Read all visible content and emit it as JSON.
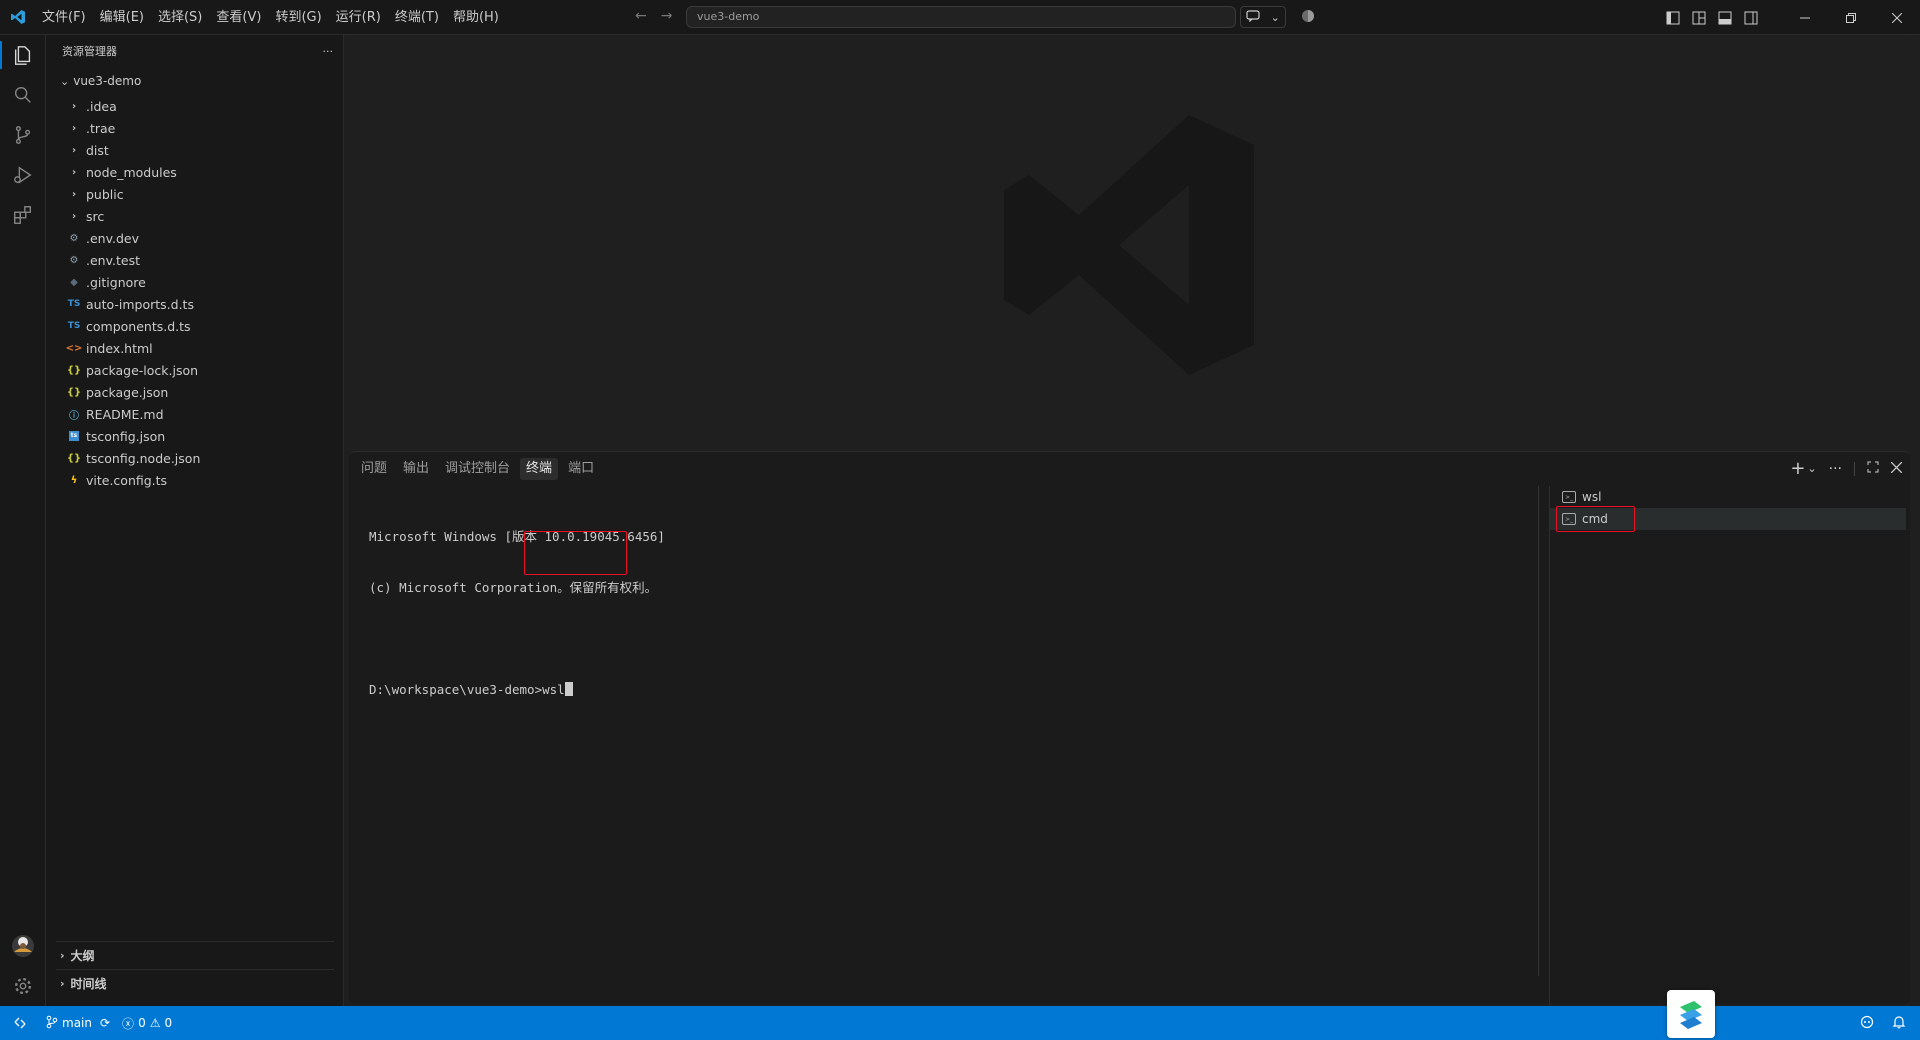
{
  "titlebar": {
    "menus": [
      "文件(F)",
      "编辑(E)",
      "选择(S)",
      "查看(V)",
      "转到(G)",
      "运行(R)",
      "终端(T)",
      "帮助(H)"
    ],
    "search_text": "vue3-demo"
  },
  "sidebar": {
    "title": "资源管理器",
    "more": "···",
    "root": "vue3-demo",
    "items": [
      {
        "label": ".idea",
        "type": "folder"
      },
      {
        "label": ".trae",
        "type": "folder"
      },
      {
        "label": "dist",
        "type": "folder"
      },
      {
        "label": "node_modules",
        "type": "folder"
      },
      {
        "label": "public",
        "type": "folder"
      },
      {
        "label": "src",
        "type": "folder"
      },
      {
        "label": ".env.dev",
        "type": "gear-icon",
        "color": "#8e9fb0"
      },
      {
        "label": ".env.test",
        "type": "gear-icon",
        "color": "#8e9fb0"
      },
      {
        "label": ".gitignore",
        "type": "git-icon",
        "color": "#5a6b7b"
      },
      {
        "label": "auto-imports.d.ts",
        "type": "ts-icon",
        "color": "#3d8fd1"
      },
      {
        "label": "components.d.ts",
        "type": "ts-icon",
        "color": "#3d8fd1"
      },
      {
        "label": "index.html",
        "type": "html-icon",
        "color": "#e37933"
      },
      {
        "label": "package-lock.json",
        "type": "json-icon",
        "color": "#cbcb41"
      },
      {
        "label": "package.json",
        "type": "json-icon",
        "color": "#cbcb41"
      },
      {
        "label": "README.md",
        "type": "info-icon",
        "color": "#519aba"
      },
      {
        "label": "tsconfig.json",
        "type": "tsconfig-icon",
        "color": "#3d8fd1"
      },
      {
        "label": "tsconfig.node.json",
        "type": "json-icon",
        "color": "#cbcb41"
      },
      {
        "label": "vite.config.ts",
        "type": "vite-icon",
        "color": "#ffc517"
      }
    ],
    "sections": [
      "大纲",
      "时间线"
    ]
  },
  "panel": {
    "tabs": [
      "问题",
      "输出",
      "调试控制台",
      "终端",
      "端口"
    ],
    "active_tab": "终端",
    "terminal_lines": [
      "Microsoft Windows [版本 10.0.19045.6456]",
      "(c) Microsoft Corporation。保留所有权利。",
      ""
    ],
    "prompt": "D:\\workspace\\vue3-demo>",
    "command": "wsl",
    "terminals": [
      {
        "label": "wsl"
      },
      {
        "label": "cmd"
      }
    ]
  },
  "statusbar": {
    "branch": "main",
    "errors": "0",
    "warnings": "0"
  },
  "colors": {
    "accent": "#0078d4",
    "highlight": "#e81123"
  }
}
